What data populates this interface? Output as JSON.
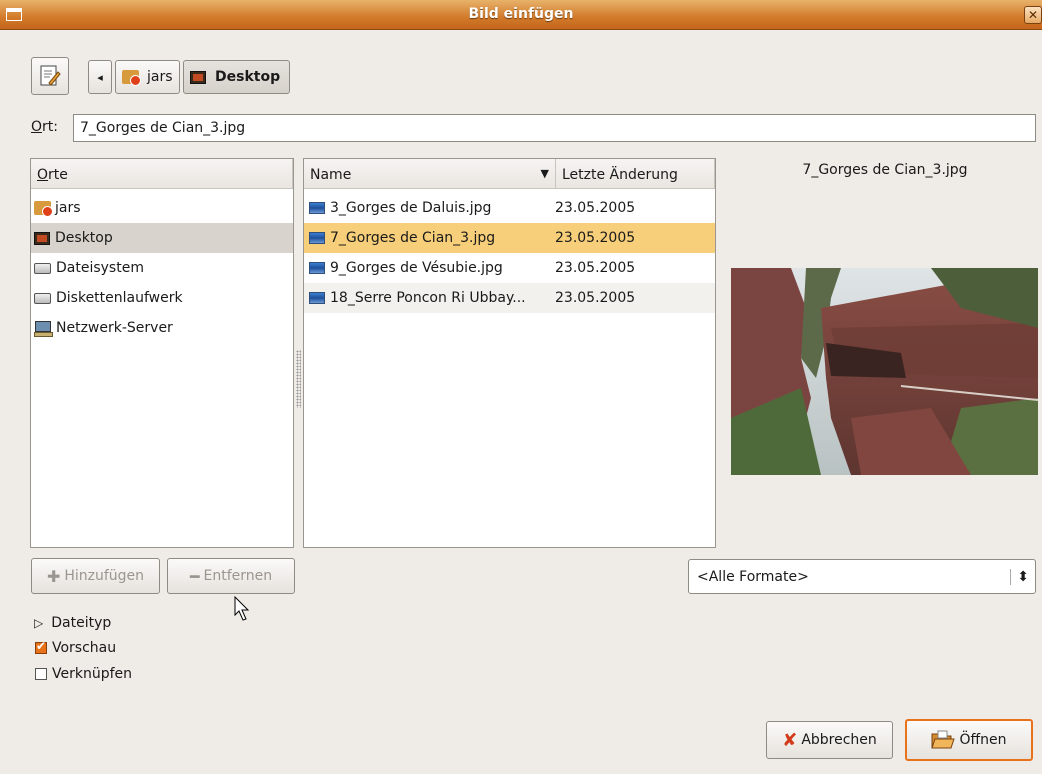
{
  "window": {
    "title": "Bild einfügen",
    "close_glyph": "✕"
  },
  "pathbar": {
    "back_glyph": "◂",
    "crumbs": [
      "jars",
      "Desktop"
    ]
  },
  "location": {
    "label": "Ort:",
    "value": "7_Gorges de Cian_3.jpg"
  },
  "places": {
    "header": "Orte",
    "items": [
      {
        "label": "jars",
        "icon": "home-folder-icon"
      },
      {
        "label": "Desktop",
        "icon": "desktop-icon",
        "selected": true
      },
      {
        "label": "Dateisystem",
        "icon": "drive-icon"
      },
      {
        "label": "Diskettenlaufwerk",
        "icon": "floppy-icon"
      },
      {
        "label": "Netzwerk-Server",
        "icon": "network-icon"
      }
    ]
  },
  "files": {
    "col_name": "Name",
    "col_modified": "Letzte Änderung",
    "sort_glyph": "▼",
    "rows": [
      {
        "name": "3_Gorges de Daluis.jpg",
        "date": "23.05.2005"
      },
      {
        "name": "7_Gorges de Cian_3.jpg",
        "date": "23.05.2005",
        "selected": true
      },
      {
        "name": "9_Gorges de Vésubie.jpg",
        "date": "23.05.2005"
      },
      {
        "name": "18_Serre Poncon Ri Ubbay...",
        "date": "23.05.2005"
      }
    ]
  },
  "preview": {
    "filename": "7_Gorges de Cian_3.jpg"
  },
  "buttons": {
    "add": "Hinzufügen",
    "remove": "Entfernen",
    "cancel": "Abbrechen",
    "open": "Öffnen"
  },
  "filter": {
    "selected": "<Alle Formate>",
    "spin_glyph": "⬍"
  },
  "options": {
    "filetype": "Dateityp",
    "preview": "Vorschau",
    "link": "Verknüpfen",
    "preview_checked": true,
    "link_checked": false
  },
  "colors": {
    "selection": "#f7cf7a",
    "accent": "#e8721a",
    "titlebar": "#d27a2a"
  }
}
